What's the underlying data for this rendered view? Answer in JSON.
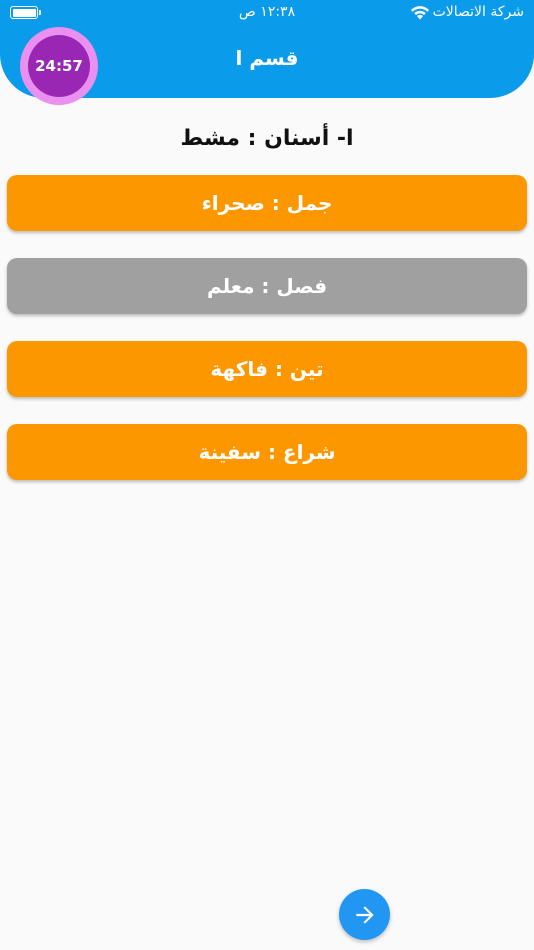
{
  "status_bar": {
    "carrier": "شركة الاتصالات",
    "time": "١٢:٣٨ ص",
    "wifi_icon": "wifi-icon",
    "battery_icon": "battery-icon",
    "battery_level": 1.0
  },
  "header": {
    "title": "قسم ا",
    "timer": "24:57"
  },
  "question": {
    "text": "ا- أسنان : مشط"
  },
  "options": [
    {
      "label": "جمل : صحراء",
      "color": "#fd9700"
    },
    {
      "label": "فصل : معلم",
      "color": "#a0a0a0"
    },
    {
      "label": "تين : فاكهة",
      "color": "#fd9700"
    },
    {
      "label": "شراع : سفينة",
      "color": "#fd9700"
    }
  ],
  "footer": {
    "next_icon": "arrow-right-icon"
  },
  "colors": {
    "appbar": "#0a9bea",
    "timer_outer": "#e990f0",
    "timer_inner": "#9a27b3",
    "next_button": "#2196f3"
  }
}
